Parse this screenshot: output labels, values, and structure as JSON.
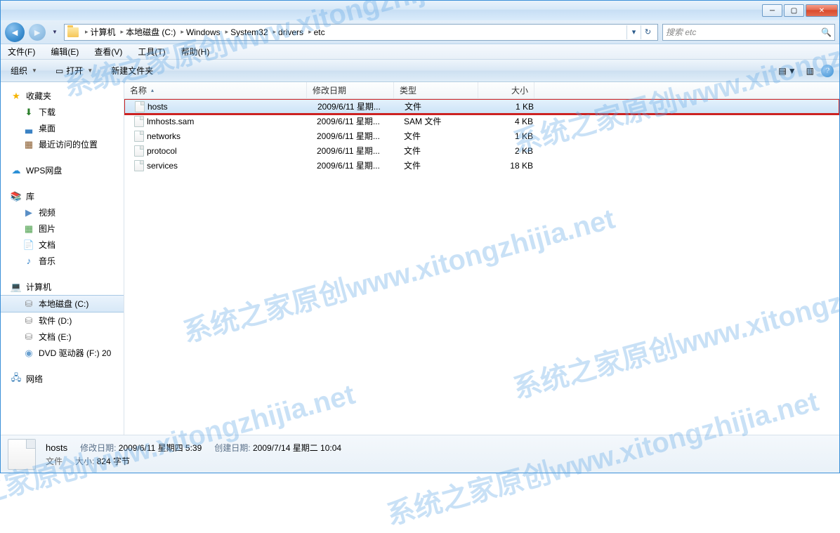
{
  "titlebar": {
    "min": "─",
    "max": "▢",
    "close": "✕"
  },
  "nav": {
    "back": "◄",
    "fwd": "►",
    "hist": "▼",
    "crumbs": [
      "计算机",
      "本地磁盘 (C:)",
      "Windows",
      "System32",
      "drivers",
      "etc"
    ],
    "sep": "▸",
    "refresh": "↻",
    "dropdown": "▾"
  },
  "search": {
    "placeholder": "搜索 etc",
    "icon": "🔍"
  },
  "menu": [
    "文件(F)",
    "编辑(E)",
    "查看(V)",
    "工具(T)",
    "帮助(H)"
  ],
  "toolbar": {
    "organize": "组织",
    "open": "打开",
    "open_icon": "▭",
    "new_folder": "新建文件夹",
    "view_icon": "▤",
    "help": "?"
  },
  "sidebar": {
    "favorites": {
      "label": "收藏夹",
      "items": [
        "下载",
        "桌面",
        "最近访问的位置"
      ]
    },
    "wps": "WPS网盘",
    "libraries": {
      "label": "库",
      "items": [
        "视频",
        "图片",
        "文档",
        "音乐"
      ]
    },
    "computer": {
      "label": "计算机",
      "items": [
        "本地磁盘 (C:)",
        "软件 (D:)",
        "文档 (E:)",
        "DVD 驱动器 (F:) 20"
      ]
    },
    "network": "网络"
  },
  "columns": {
    "name": "名称",
    "date": "修改日期",
    "type": "类型",
    "size": "大小"
  },
  "files": [
    {
      "name": "hosts",
      "date": "2009/6/11 星期...",
      "type": "文件",
      "size": "1 KB",
      "selected": true,
      "highlight": true
    },
    {
      "name": "lmhosts.sam",
      "date": "2009/6/11 星期...",
      "type": "SAM 文件",
      "size": "4 KB"
    },
    {
      "name": "networks",
      "date": "2009/6/11 星期...",
      "type": "文件",
      "size": "1 KB"
    },
    {
      "name": "protocol",
      "date": "2009/6/11 星期...",
      "type": "文件",
      "size": "2 KB"
    },
    {
      "name": "services",
      "date": "2009/6/11 星期...",
      "type": "文件",
      "size": "18 KB"
    }
  ],
  "details": {
    "name": "hosts",
    "type": "文件",
    "mod_lbl": "修改日期:",
    "mod_val": "2009/6/11 星期四 5:39",
    "crt_lbl": "创建日期:",
    "crt_val": "2009/7/14 星期二 10:04",
    "size_lbl": "大小:",
    "size_val": "824 字节"
  },
  "watermark": "系统之家原创www.xitongzhijia.net"
}
